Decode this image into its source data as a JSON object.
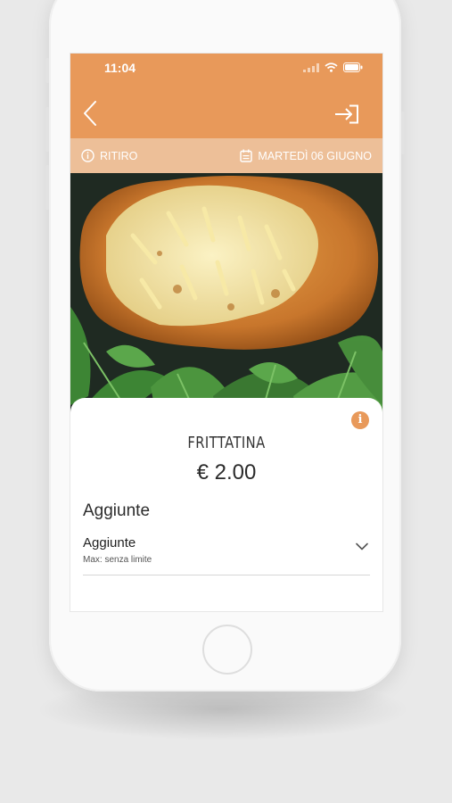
{
  "status_bar": {
    "time": "11:04"
  },
  "header": {
    "back_icon": "back-arrow-icon",
    "login_icon": "login-icon"
  },
  "info_bar": {
    "mode_label": "RITIRO",
    "date_label": "MARTEDÌ 06 GIUGNO"
  },
  "product": {
    "name": "FRITTATINA",
    "price": "€ 2.00",
    "info_icon_glyph": "i"
  },
  "addons": {
    "section_title": "Aggiunte",
    "group_label": "Aggiunte",
    "group_limit": "Max: senza limite"
  },
  "colors": {
    "accent": "#e8995a",
    "accent_light": "#edbf98"
  }
}
